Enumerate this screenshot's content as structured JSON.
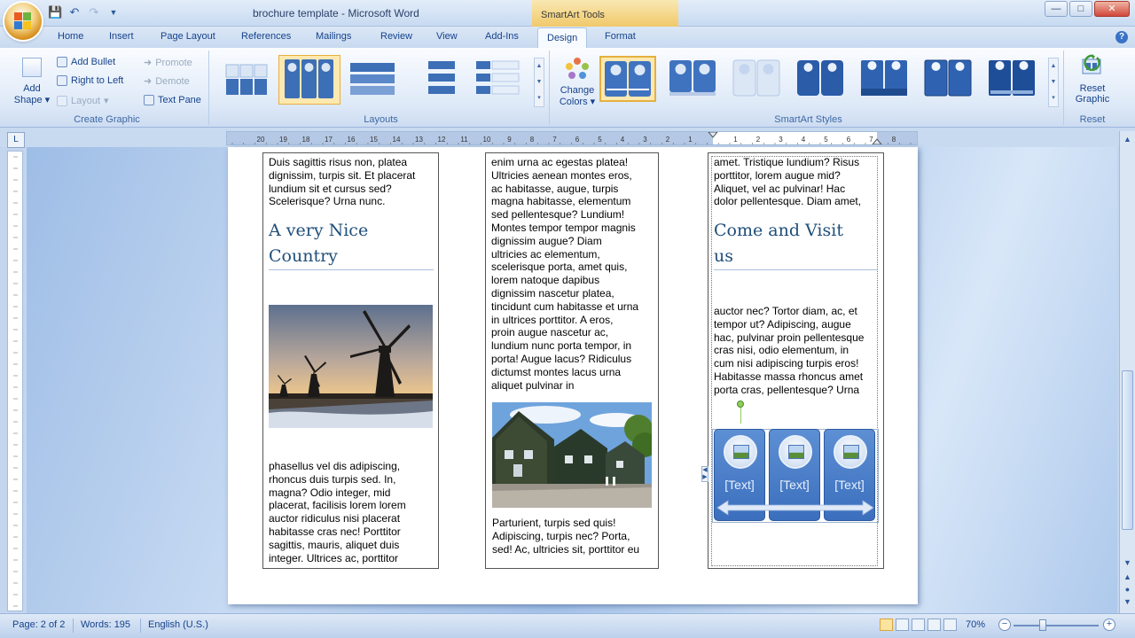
{
  "window": {
    "title": "brochure template - Microsoft Word",
    "contextual_tools": "SmartArt Tools",
    "controls": [
      "minimize",
      "maximize",
      "close"
    ]
  },
  "qat": {
    "icons": [
      "save-icon",
      "undo-icon",
      "redo-icon",
      "customize-icon"
    ]
  },
  "tabs": [
    "Home",
    "Insert",
    "Page Layout",
    "References",
    "Mailings",
    "Review",
    "View",
    "Add-Ins",
    "Design",
    "Format"
  ],
  "active_tab": "Design",
  "ribbon": {
    "create_graphic": {
      "label": "Create Graphic",
      "add_shape": "Add",
      "add_shape_2": "Shape",
      "add_bullet": "Add Bullet",
      "right_to_left": "Right to Left",
      "layout": "Layout",
      "promote": "Promote",
      "demote": "Demote",
      "text_pane": "Text Pane"
    },
    "layouts": {
      "label": "Layouts",
      "selected_index": 1
    },
    "smartart_styles": {
      "label": "SmartArt Styles",
      "change_colors": "Change",
      "change_colors_2": "Colors",
      "selected_index": 0
    },
    "reset": {
      "label": "Reset",
      "reset_graphic": "Reset",
      "reset_graphic_2": "Graphic"
    }
  },
  "ruler": {
    "corner": "L",
    "left_ticks": [
      "20",
      "19",
      "18",
      "17",
      "16",
      "15",
      "14",
      "13",
      "12",
      "11",
      "10",
      "9",
      "8",
      "7",
      "6",
      "5",
      "4",
      "3",
      "2",
      "1"
    ],
    "right_ticks": [
      "1",
      "2",
      "3",
      "4",
      "5",
      "6",
      "7",
      "8"
    ]
  },
  "document": {
    "col1": {
      "top_text": "Duis sagittis risus non, platea\ndignissim, turpis sit. Et placerat\nlundium sit et cursus sed?\nScelerisque? Urna nunc.",
      "heading": "A very Nice\nCountry",
      "photo": "windmills-photo",
      "bottom_text": "phasellus vel dis adipiscing,\nrhoncus duis turpis sed. In,\nmagna? Odio integer, mid\nplacerat, facilisis lorem lorem\nauctor ridiculus nisi placerat\nhabitasse cras nec! Porttitor\nsagittis, mauris, aliquet duis\ninteger. Ultrices ac, porttitor"
    },
    "col2": {
      "top_text": "enim urna ac egestas platea!\nUltricies aenean montes eros,\nac habitasse, augue, turpis\nmagna habitasse, elementum\nsed pellentesque? Lundium!\nMontes tempor tempor magnis\ndignissim augue? Diam\nultricies ac elementum,\nscelerisque porta, amet quis,\nlorem natoque dapibus\ndignissim nascetur platea,\ntincidunt cum habitasse et urna\nin ultrices porttitor. A eros,\nproin augue nascetur ac,\nlundium nunc porta tempor, in\nporta! Augue lacus? Ridiculus\ndictumst montes lacus urna\naliquet pulvinar in",
      "photo": "village-houses-photo",
      "bottom_text": "Parturient, turpis sed quis!\nAdipiscing, turpis nec? Porta,\nsed! Ac, ultricies sit, porttitor eu"
    },
    "col3": {
      "top_text": "amet. Tristique lundium? Risus\nporttitor, lorem augue mid?\nAliquet, vel ac pulvinar! Hac\ndolor pellentesque. Diam amet,",
      "heading": "Come and Visit\nus",
      "mid_text": "auctor nec? Tortor diam, ac, et\ntempor ut? Adipiscing, augue\nhac, pulvinar proin pellentesque\ncras nisi, odio elementum, in\ncum nisi adipiscing turpis eros!\nHabitasse massa rhoncus amet\nporta cras, pellentesque? Urna",
      "smartart": [
        "[Text]",
        "[Text]",
        "[Text]"
      ]
    }
  },
  "status": {
    "page": "Page: 2 of 2",
    "words": "Words: 195",
    "language": "English (U.S.)",
    "zoom": "70%",
    "zoom_level_percent": 70
  },
  "colors": {
    "accent": "#15428b",
    "smartart_fill": "#3b6fbd",
    "heading": "#1f4e79"
  }
}
